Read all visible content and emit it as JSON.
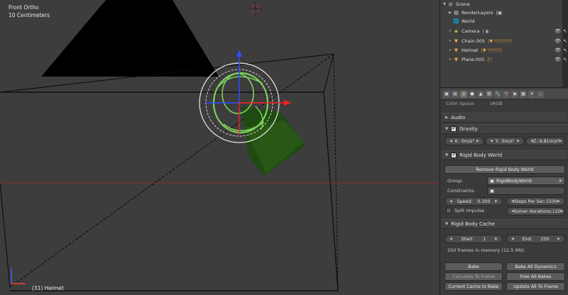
{
  "viewport": {
    "view_label": "Front Ortho",
    "units_label": "10 Centimeters",
    "object_label": "(31) Helmet"
  },
  "outliner": {
    "items": [
      {
        "name": "Scene",
        "icon": "scene-icon"
      },
      {
        "name": "RenderLayers",
        "icon": "renderlayers-icon"
      },
      {
        "name": "World",
        "icon": "world-icon"
      },
      {
        "name": "Camera",
        "icon": "camera-icon"
      },
      {
        "name": "Chain.005",
        "icon": "mesh-icon"
      },
      {
        "name": "Helmet",
        "icon": "mesh-icon"
      },
      {
        "name": "Plane.005",
        "icon": "mesh-icon"
      }
    ]
  },
  "properties": {
    "color_space_label": "Color Space:",
    "color_space_value": "sRGB",
    "audio": {
      "title": "Audio"
    },
    "gravity": {
      "title": "Gravity",
      "x_label": "X:",
      "x_value": "0m/s²",
      "y_label": "Y:",
      "y_value": "0m/s²",
      "z_label": "Z:",
      "z_value": "-9.81m/s²"
    },
    "rigid_body_world": {
      "title": "Rigid Body World",
      "remove_button": "Remove Rigid Body World",
      "group_label": "Group:",
      "group_value": "RigidBodyWorld",
      "constraints_label": "Constraints:",
      "speed_label": "Speed:",
      "speed_value": "0.300",
      "steps_label": "Steps Per Sec:",
      "steps_value": "1500",
      "split_impulse_label": "Split Impulse",
      "solver_label": "Solver Iterations:",
      "solver_value": "120"
    },
    "rigid_body_cache": {
      "title": "Rigid Body Cache",
      "start_label": "Start:",
      "start_value": "1",
      "end_label": "End:",
      "end_value": "250",
      "memory_text": "250 frames in memory (12.5 Mb).",
      "bake_button": "Bake",
      "bake_all_button": "Bake All Dynamics",
      "calc_button": "Calculate To Frame",
      "free_all_button": "Free All Bakes",
      "current_cache_button": "Current Cache to Bake",
      "update_all_button": "Update All To Frame"
    }
  }
}
